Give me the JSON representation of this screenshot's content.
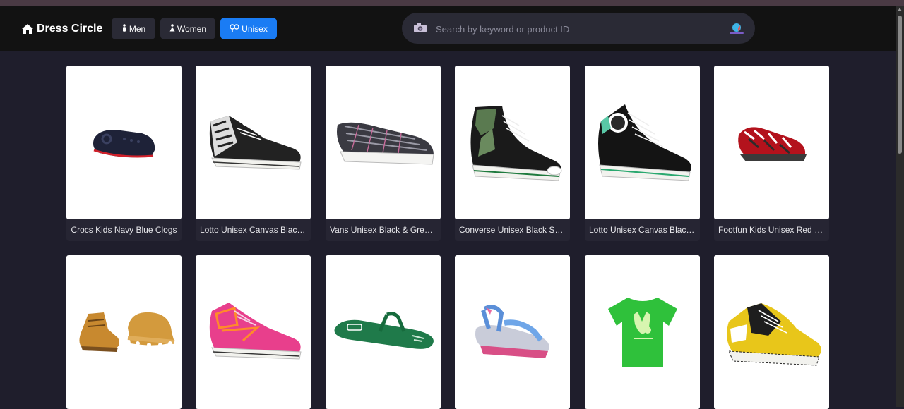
{
  "brand": {
    "name": "Dress Circle",
    "icon": "home-icon"
  },
  "nav": [
    {
      "label": "Men",
      "icon": "male-icon"
    },
    {
      "label": "Women",
      "icon": "female-icon"
    },
    {
      "label": "Unisex",
      "icon": "unisex-icon",
      "active": true
    }
  ],
  "search": {
    "placeholder": "Search by keyword or product ID",
    "value": "",
    "camera_icon": "camera-icon",
    "voice_icon": "voice-search-icon"
  },
  "products": [
    {
      "title": "Crocs Kids Navy Blue Clogs",
      "kind": "clog"
    },
    {
      "title": "Lotto Unisex Canvas Black ...",
      "kind": "sneaker-pattern"
    },
    {
      "title": "Vans Unisex Black & Grey C...",
      "kind": "slipon"
    },
    {
      "title": "Converse Unisex Black Shoes",
      "kind": "hightop"
    },
    {
      "title": "Lotto Unisex Canvas Black ...",
      "kind": "hightop2"
    },
    {
      "title": "Footfun Kids Unisex Red Sh...",
      "kind": "kidshoe"
    },
    {
      "title": "",
      "kind": "babyboot"
    },
    {
      "title": "",
      "kind": "pinksneaker"
    },
    {
      "title": "",
      "kind": "flipflop"
    },
    {
      "title": "",
      "kind": "sandal"
    },
    {
      "title": "",
      "kind": "tshirt"
    },
    {
      "title": "",
      "kind": "yellowsneaker"
    }
  ],
  "colors": {
    "accent": "#1a7cf4",
    "background": "#1f1e2c",
    "header": "#121212"
  }
}
